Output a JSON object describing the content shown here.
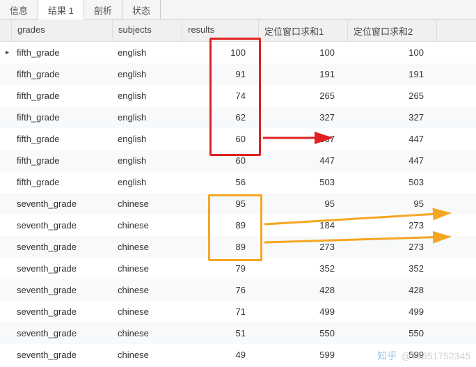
{
  "tabs": [
    {
      "label": "信息"
    },
    {
      "label": "结果 1"
    },
    {
      "label": "剖析"
    },
    {
      "label": "状态"
    }
  ],
  "activeTabIndex": 1,
  "headers": {
    "grades": "grades",
    "subjects": "subjects",
    "results": "results",
    "sum1": "定位窗口求和1",
    "sum2": "定位窗口求和2"
  },
  "rows": [
    {
      "marker": "▸",
      "grades": "fifth_grade",
      "subjects": "english",
      "results": "100",
      "sum1": "100",
      "sum2": "100"
    },
    {
      "marker": "",
      "grades": "fifth_grade",
      "subjects": "english",
      "results": "91",
      "sum1": "191",
      "sum2": "191"
    },
    {
      "marker": "",
      "grades": "fifth_grade",
      "subjects": "english",
      "results": "74",
      "sum1": "265",
      "sum2": "265"
    },
    {
      "marker": "",
      "grades": "fifth_grade",
      "subjects": "english",
      "results": "62",
      "sum1": "327",
      "sum2": "327"
    },
    {
      "marker": "",
      "grades": "fifth_grade",
      "subjects": "english",
      "results": "60",
      "sum1": "387",
      "sum2": "447"
    },
    {
      "marker": "",
      "grades": "fifth_grade",
      "subjects": "english",
      "results": "60",
      "sum1": "447",
      "sum2": "447"
    },
    {
      "marker": "",
      "grades": "fifth_grade",
      "subjects": "english",
      "results": "56",
      "sum1": "503",
      "sum2": "503"
    },
    {
      "marker": "",
      "grades": "seventh_grade",
      "subjects": "chinese",
      "results": "95",
      "sum1": "95",
      "sum2": "95"
    },
    {
      "marker": "",
      "grades": "seventh_grade",
      "subjects": "chinese",
      "results": "89",
      "sum1": "184",
      "sum2": "273"
    },
    {
      "marker": "",
      "grades": "seventh_grade",
      "subjects": "chinese",
      "results": "89",
      "sum1": "273",
      "sum2": "273"
    },
    {
      "marker": "",
      "grades": "seventh_grade",
      "subjects": "chinese",
      "results": "79",
      "sum1": "352",
      "sum2": "352"
    },
    {
      "marker": "",
      "grades": "seventh_grade",
      "subjects": "chinese",
      "results": "76",
      "sum1": "428",
      "sum2": "428"
    },
    {
      "marker": "",
      "grades": "seventh_grade",
      "subjects": "chinese",
      "results": "71",
      "sum1": "499",
      "sum2": "499"
    },
    {
      "marker": "",
      "grades": "seventh_grade",
      "subjects": "chinese",
      "results": "51",
      "sum1": "550",
      "sum2": "550"
    },
    {
      "marker": "",
      "grades": "seventh_grade",
      "subjects": "chinese",
      "results": "49",
      "sum1": "599",
      "sum2": "599"
    }
  ],
  "watermark": {
    "brand": "知乎",
    "handle": "@13651752345"
  }
}
